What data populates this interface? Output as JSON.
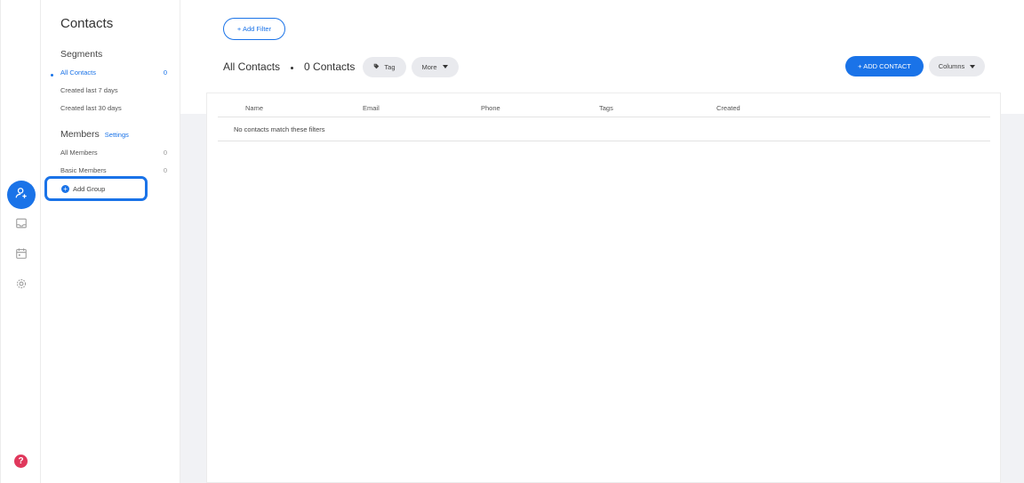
{
  "rail": {
    "items": [
      {
        "name": "contacts-icon",
        "active": true
      },
      {
        "name": "inbox-icon",
        "active": false
      },
      {
        "name": "calendar-icon",
        "active": false
      },
      {
        "name": "settings-gear-icon",
        "active": false
      }
    ],
    "help_label": "?"
  },
  "sidebar": {
    "title": "Contacts",
    "segments_heading": "Segments",
    "segments": [
      {
        "label": "All Contacts",
        "count": "0"
      },
      {
        "label": "Created last 7 days",
        "count": ""
      },
      {
        "label": "Created last 30 days",
        "count": ""
      }
    ],
    "members_heading": "Members",
    "members_settings": "Settings",
    "members": [
      {
        "label": "All Members",
        "count": "0"
      },
      {
        "label": "Basic Members",
        "count": "0"
      }
    ],
    "add_group_label": "Add Group",
    "add_group_plus": "+"
  },
  "toolbar": {
    "add_filter_label": "+ Add Filter",
    "title": "All Contacts",
    "count_label": "0 Contacts",
    "tag_label": "Tag",
    "more_label": "More",
    "add_contact_label": "+ ADD CONTACT",
    "columns_label": "Columns"
  },
  "table": {
    "columns": [
      "Name",
      "Email",
      "Phone",
      "Tags",
      "Created"
    ],
    "empty_message": "No contacts match these filters"
  },
  "colors": {
    "accent": "#1a73e8",
    "help": "#e0385c",
    "pill_bg": "#e9eaee",
    "page_bg": "#f1f2f5"
  }
}
